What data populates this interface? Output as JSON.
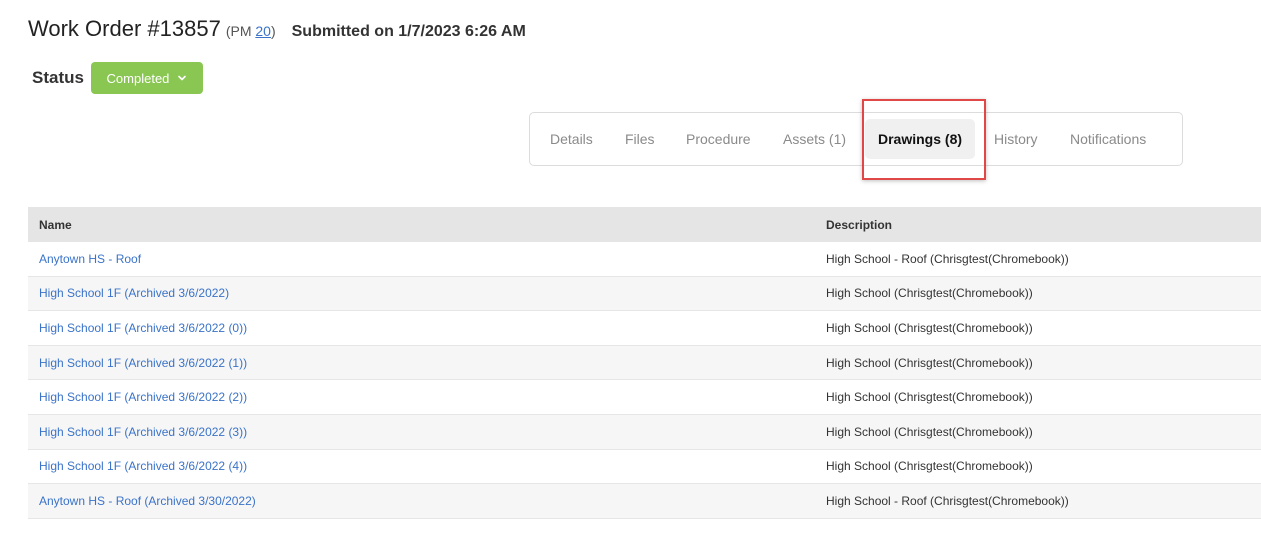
{
  "header": {
    "title": "Work Order #13857",
    "pm_prefix": "(PM ",
    "pm_link": "20",
    "pm_suffix": ")",
    "submitted": "Submitted on 1/7/2023 6:26 AM"
  },
  "status": {
    "label": "Status",
    "value": "Completed",
    "color": "#8ac752"
  },
  "tabs": [
    {
      "label": "Details"
    },
    {
      "label": "Files"
    },
    {
      "label": "Procedure"
    },
    {
      "label": "Assets (1)"
    },
    {
      "label": "Drawings (8)",
      "active": true
    },
    {
      "label": "History"
    },
    {
      "label": "Notifications"
    }
  ],
  "table": {
    "columns": [
      "Name",
      "Description"
    ],
    "rows": [
      {
        "name": "Anytown HS - Roof",
        "description": "High School - Roof (Chrisgtest(Chromebook))"
      },
      {
        "name": "High School 1F (Archived 3/6/2022)",
        "description": "High School (Chrisgtest(Chromebook))"
      },
      {
        "name": "High School 1F (Archived 3/6/2022 (0))",
        "description": "High School (Chrisgtest(Chromebook))"
      },
      {
        "name": "High School 1F (Archived 3/6/2022 (1))",
        "description": "High School (Chrisgtest(Chromebook))"
      },
      {
        "name": "High School 1F (Archived 3/6/2022 (2))",
        "description": "High School (Chrisgtest(Chromebook))"
      },
      {
        "name": "High School 1F (Archived 3/6/2022 (3))",
        "description": "High School (Chrisgtest(Chromebook))"
      },
      {
        "name": "High School 1F (Archived 3/6/2022 (4))",
        "description": "High School (Chrisgtest(Chromebook))"
      },
      {
        "name": "Anytown HS - Roof (Archived 3/30/2022)",
        "description": "High School - Roof (Chrisgtest(Chromebook))"
      }
    ]
  },
  "colors": {
    "link": "#3a73c9",
    "highlight": "#e04848",
    "header_bg": "#e5e5e5"
  }
}
